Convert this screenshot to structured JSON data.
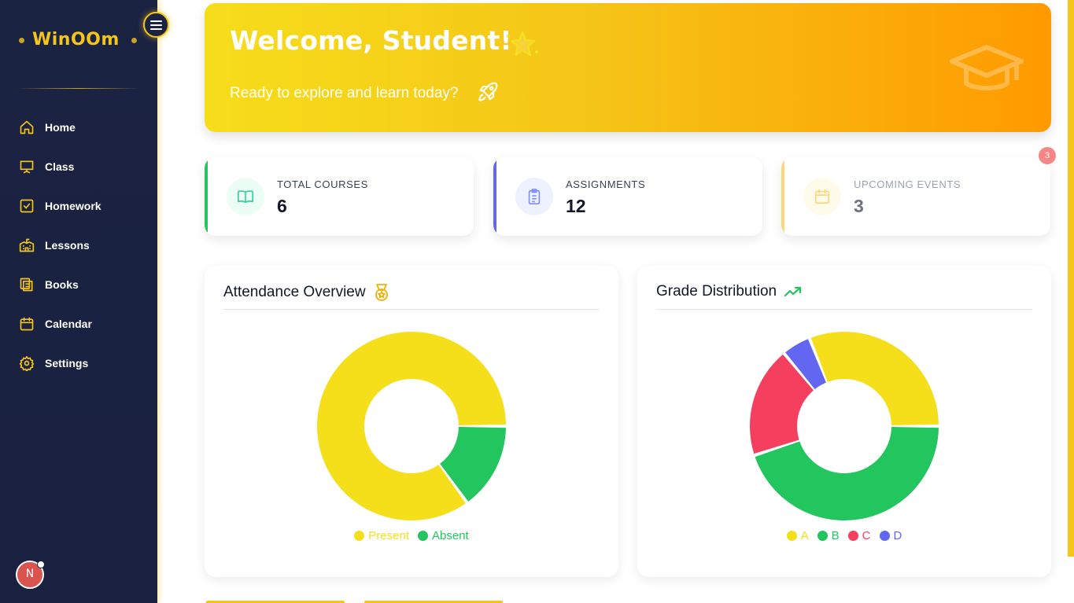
{
  "app": {
    "logo_text": "WinOOm"
  },
  "sidebar": {
    "items": [
      {
        "label": "Home",
        "icon": "home-icon"
      },
      {
        "label": "Class",
        "icon": "presentation-icon"
      },
      {
        "label": "Homework",
        "icon": "checkbox-icon"
      },
      {
        "label": "Lessons",
        "icon": "school-icon"
      },
      {
        "label": "Books",
        "icon": "books-icon"
      },
      {
        "label": "Calendar",
        "icon": "calendar-icon"
      },
      {
        "label": "Settings",
        "icon": "gear-icon"
      }
    ],
    "avatar_letter": "N"
  },
  "banner": {
    "title": "Welcome, Student!",
    "subtitle": "Ready to explore and learn today?"
  },
  "stats": [
    {
      "label": "TOTAL COURSES",
      "value": "6",
      "color": "#22c55e"
    },
    {
      "label": "ASSIGNMENTS",
      "value": "12",
      "color": "#6366f1"
    },
    {
      "label": "UPCOMING EVENTS",
      "value": "3",
      "color": "#f5c518"
    }
  ],
  "notification_count": "3",
  "colors": {
    "accent": "#f5c518",
    "sidebar_bg": "#1b2342",
    "green": "#22c55e",
    "red": "#f43f5e",
    "indigo": "#6366f1"
  },
  "chart_data": [
    {
      "type": "pie",
      "title": "Attendance Overview",
      "categories": [
        "Present",
        "Absent"
      ],
      "values": [
        85,
        15
      ],
      "colors": [
        "#f5de1a",
        "#22c55e"
      ],
      "legend": "bottom"
    },
    {
      "type": "pie",
      "title": "Grade Distribution",
      "categories": [
        "A",
        "B",
        "C",
        "D"
      ],
      "values": [
        31,
        45,
        19,
        5
      ],
      "colors": [
        "#f5de1a",
        "#22c55e",
        "#f43f5e",
        "#6366f1"
      ],
      "legend": "bottom"
    }
  ]
}
